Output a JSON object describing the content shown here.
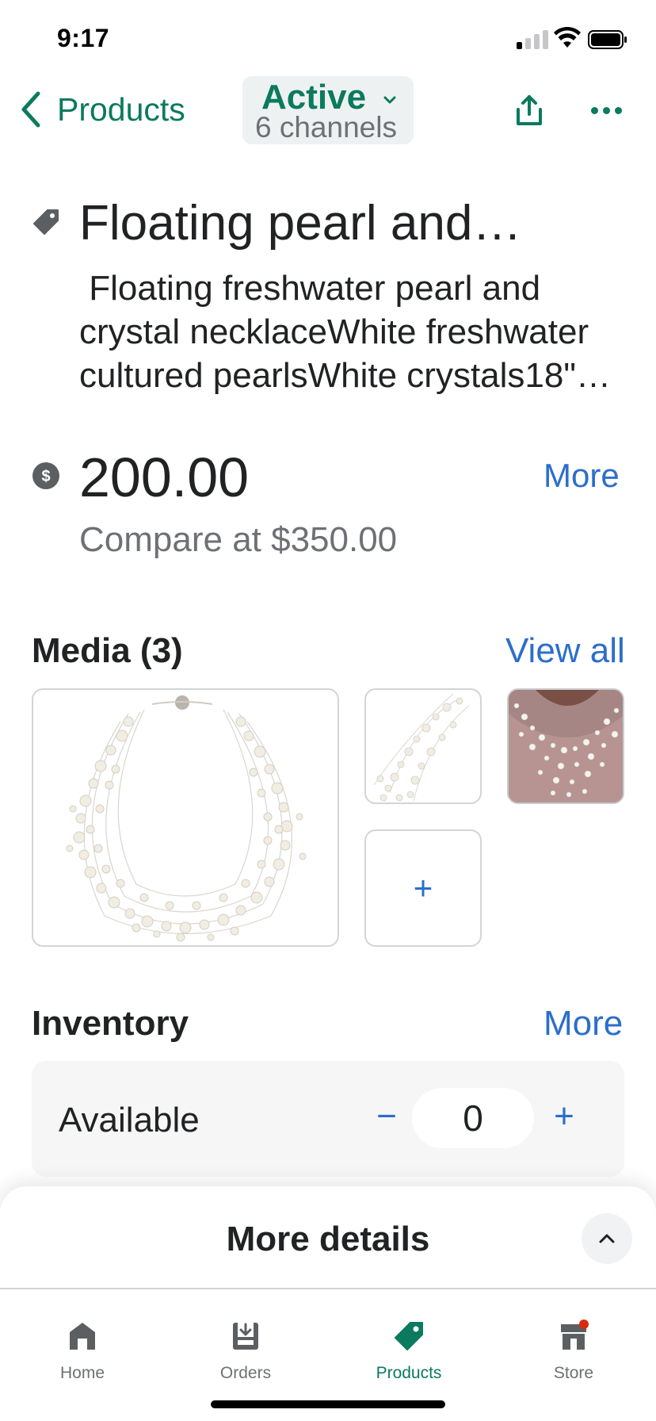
{
  "status_bar": {
    "time": "9:17"
  },
  "header": {
    "back_label": "Products",
    "status": "Active",
    "channels": "6 channels"
  },
  "product": {
    "title": "Floating pearl and…",
    "description": " Floating freshwater pearl and crystal necklaceWhite freshwater cultured pearlsWhite crystals18\"…",
    "price": "200.00",
    "price_more": "More",
    "compare_at": "Compare at $350.00"
  },
  "media": {
    "heading": "Media (3)",
    "view_all": "View all",
    "add_symbol": "+"
  },
  "inventory": {
    "heading": "Inventory",
    "more": "More",
    "available_label": "Available",
    "minus": "−",
    "quantity": "0",
    "plus": "+"
  },
  "sheet": {
    "title": "More details"
  },
  "tabs": [
    {
      "label": "Home",
      "icon": "home-icon"
    },
    {
      "label": "Orders",
      "icon": "orders-icon"
    },
    {
      "label": "Products",
      "icon": "tag-icon",
      "active": true
    },
    {
      "label": "Store",
      "icon": "store-icon",
      "badge": true
    }
  ],
  "colors": {
    "brand_green": "#0b7a5e",
    "link_blue": "#2c6ecb",
    "badge_red": "#d82c0d"
  }
}
